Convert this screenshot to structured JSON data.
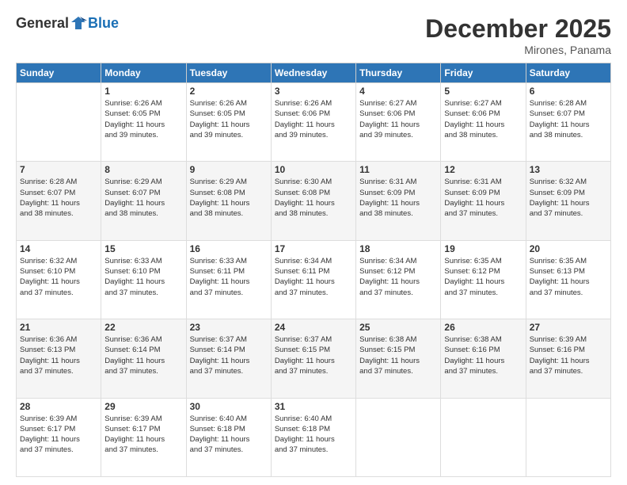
{
  "logo": {
    "general": "General",
    "blue": "Blue"
  },
  "title": "December 2025",
  "subtitle": "Mirones, Panama",
  "days": [
    "Sunday",
    "Monday",
    "Tuesday",
    "Wednesday",
    "Thursday",
    "Friday",
    "Saturday"
  ],
  "weeks": [
    [
      {
        "day": "",
        "content": ""
      },
      {
        "day": "1",
        "content": "Sunrise: 6:26 AM\nSunset: 6:05 PM\nDaylight: 11 hours\nand 39 minutes."
      },
      {
        "day": "2",
        "content": "Sunrise: 6:26 AM\nSunset: 6:05 PM\nDaylight: 11 hours\nand 39 minutes."
      },
      {
        "day": "3",
        "content": "Sunrise: 6:26 AM\nSunset: 6:06 PM\nDaylight: 11 hours\nand 39 minutes."
      },
      {
        "day": "4",
        "content": "Sunrise: 6:27 AM\nSunset: 6:06 PM\nDaylight: 11 hours\nand 39 minutes."
      },
      {
        "day": "5",
        "content": "Sunrise: 6:27 AM\nSunset: 6:06 PM\nDaylight: 11 hours\nand 38 minutes."
      },
      {
        "day": "6",
        "content": "Sunrise: 6:28 AM\nSunset: 6:07 PM\nDaylight: 11 hours\nand 38 minutes."
      }
    ],
    [
      {
        "day": "7",
        "content": "Sunrise: 6:28 AM\nSunset: 6:07 PM\nDaylight: 11 hours\nand 38 minutes."
      },
      {
        "day": "8",
        "content": "Sunrise: 6:29 AM\nSunset: 6:07 PM\nDaylight: 11 hours\nand 38 minutes."
      },
      {
        "day": "9",
        "content": "Sunrise: 6:29 AM\nSunset: 6:08 PM\nDaylight: 11 hours\nand 38 minutes."
      },
      {
        "day": "10",
        "content": "Sunrise: 6:30 AM\nSunset: 6:08 PM\nDaylight: 11 hours\nand 38 minutes."
      },
      {
        "day": "11",
        "content": "Sunrise: 6:31 AM\nSunset: 6:09 PM\nDaylight: 11 hours\nand 38 minutes."
      },
      {
        "day": "12",
        "content": "Sunrise: 6:31 AM\nSunset: 6:09 PM\nDaylight: 11 hours\nand 37 minutes."
      },
      {
        "day": "13",
        "content": "Sunrise: 6:32 AM\nSunset: 6:09 PM\nDaylight: 11 hours\nand 37 minutes."
      }
    ],
    [
      {
        "day": "14",
        "content": "Sunrise: 6:32 AM\nSunset: 6:10 PM\nDaylight: 11 hours\nand 37 minutes."
      },
      {
        "day": "15",
        "content": "Sunrise: 6:33 AM\nSunset: 6:10 PM\nDaylight: 11 hours\nand 37 minutes."
      },
      {
        "day": "16",
        "content": "Sunrise: 6:33 AM\nSunset: 6:11 PM\nDaylight: 11 hours\nand 37 minutes."
      },
      {
        "day": "17",
        "content": "Sunrise: 6:34 AM\nSunset: 6:11 PM\nDaylight: 11 hours\nand 37 minutes."
      },
      {
        "day": "18",
        "content": "Sunrise: 6:34 AM\nSunset: 6:12 PM\nDaylight: 11 hours\nand 37 minutes."
      },
      {
        "day": "19",
        "content": "Sunrise: 6:35 AM\nSunset: 6:12 PM\nDaylight: 11 hours\nand 37 minutes."
      },
      {
        "day": "20",
        "content": "Sunrise: 6:35 AM\nSunset: 6:13 PM\nDaylight: 11 hours\nand 37 minutes."
      }
    ],
    [
      {
        "day": "21",
        "content": "Sunrise: 6:36 AM\nSunset: 6:13 PM\nDaylight: 11 hours\nand 37 minutes."
      },
      {
        "day": "22",
        "content": "Sunrise: 6:36 AM\nSunset: 6:14 PM\nDaylight: 11 hours\nand 37 minutes."
      },
      {
        "day": "23",
        "content": "Sunrise: 6:37 AM\nSunset: 6:14 PM\nDaylight: 11 hours\nand 37 minutes."
      },
      {
        "day": "24",
        "content": "Sunrise: 6:37 AM\nSunset: 6:15 PM\nDaylight: 11 hours\nand 37 minutes."
      },
      {
        "day": "25",
        "content": "Sunrise: 6:38 AM\nSunset: 6:15 PM\nDaylight: 11 hours\nand 37 minutes."
      },
      {
        "day": "26",
        "content": "Sunrise: 6:38 AM\nSunset: 6:16 PM\nDaylight: 11 hours\nand 37 minutes."
      },
      {
        "day": "27",
        "content": "Sunrise: 6:39 AM\nSunset: 6:16 PM\nDaylight: 11 hours\nand 37 minutes."
      }
    ],
    [
      {
        "day": "28",
        "content": "Sunrise: 6:39 AM\nSunset: 6:17 PM\nDaylight: 11 hours\nand 37 minutes."
      },
      {
        "day": "29",
        "content": "Sunrise: 6:39 AM\nSunset: 6:17 PM\nDaylight: 11 hours\nand 37 minutes."
      },
      {
        "day": "30",
        "content": "Sunrise: 6:40 AM\nSunset: 6:18 PM\nDaylight: 11 hours\nand 37 minutes."
      },
      {
        "day": "31",
        "content": "Sunrise: 6:40 AM\nSunset: 6:18 PM\nDaylight: 11 hours\nand 37 minutes."
      },
      {
        "day": "",
        "content": ""
      },
      {
        "day": "",
        "content": ""
      },
      {
        "day": "",
        "content": ""
      }
    ]
  ]
}
